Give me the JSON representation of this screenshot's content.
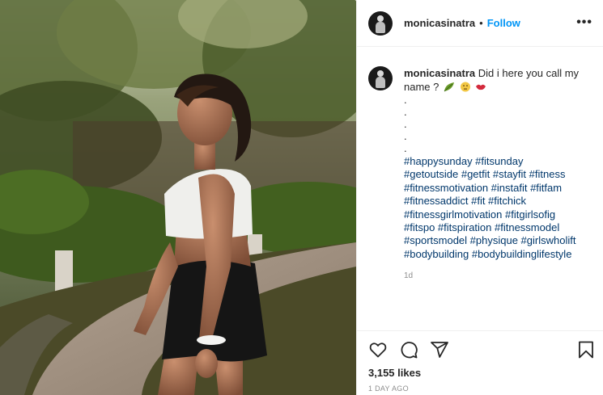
{
  "post": {
    "username": "monicasinatra",
    "separator": "•",
    "follow_label": "Follow",
    "more_label": "•••",
    "caption_text": "Did i here you call my name ?",
    "caption_dots": [
      ".",
      ".",
      ".",
      ".",
      "."
    ],
    "hashtag_lines": [
      "#happysunday #fitsunday",
      "#getoutside #getfit #stayfit #fitness",
      "#fitnessmotivation #instafit #fitfam",
      "#fitnessaddict #fit #fitchick",
      "#fitnessgirlmotivation #fitgirlsofig",
      "#fitspo #fitspiration #fitnessmodel",
      "#sportsmodel #physique #girlswholift",
      "#bodybuilding #bodybuildinglifestyle"
    ],
    "age_short": "1d",
    "likes": "3,155 likes",
    "posted_ago": "1 DAY AGO"
  },
  "icons": {
    "like": "heart-icon",
    "comment": "comment-icon",
    "share": "paper-plane-icon",
    "save": "bookmark-icon",
    "caption_emojis": [
      "leaf-icon",
      "face-icon",
      "kiss-lips-icon"
    ]
  },
  "colors": {
    "link": "#0095f6",
    "hashtag": "#00376b",
    "muted": "#8e8e8e",
    "text": "#262626"
  }
}
